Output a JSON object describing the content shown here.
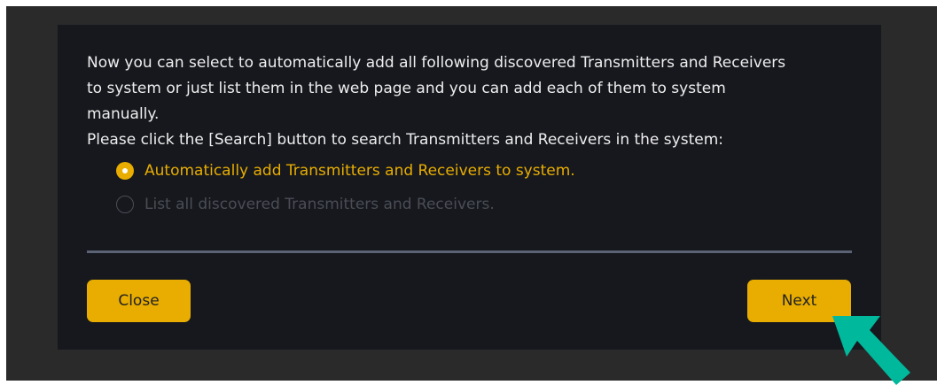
{
  "dialog": {
    "description": [
      "Now you can select to automatically add all following discovered Transmitters and Receivers",
      "to system or just list them in the web page and you can add each of them to system",
      "manually.",
      "Please click the [Search] button to search Transmitters and Receivers in the system:"
    ],
    "options": [
      {
        "label": "Automatically add Transmitters and Receivers to system.",
        "selected": true
      },
      {
        "label": "List all discovered Transmitters and Receivers.",
        "selected": false
      }
    ],
    "buttons": {
      "close_label": "Close",
      "next_label": "Next"
    }
  },
  "annotation": {
    "arrow_icon": "pointer-arrow-icon",
    "arrow_color": "#00b89c"
  },
  "colors": {
    "accent": "#e8ad00",
    "dialog_background": "#16181e",
    "backdrop": "#2a2a2a",
    "divider": "#5a6274",
    "disabled_text": "#4a4d55"
  }
}
